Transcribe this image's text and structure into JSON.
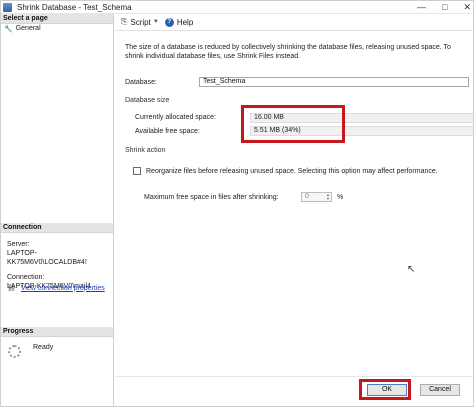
{
  "window": {
    "title": "Shrink Database - Test_Schema",
    "minimize": "—",
    "maximize": "□",
    "close": "✕"
  },
  "left_pane": {
    "select_page_header": "Select a page",
    "pages": [
      {
        "label": "General"
      }
    ],
    "connection_header": "Connection",
    "server_label": "Server:",
    "server_value": "LAPTOP-KK75M6V0\\LOCALDB#4!",
    "connection_label": "Connection:",
    "connection_value": "LAPTOP-KK75M6V0\\mail4",
    "view_connection_link": "View connection properties",
    "progress_header": "Progress",
    "progress_status": "Ready"
  },
  "toolbar": {
    "script_label": "Script",
    "help_label": "Help"
  },
  "description": "The size of a database is reduced by collectively shrinking the database files, releasing unused space. To shrink individual database files, use Shrink Files instead.",
  "database": {
    "label": "Database:",
    "value": "Test_Schema"
  },
  "database_size": {
    "section_title": "Database size",
    "allocated_label": "Currently allocated space:",
    "allocated_value": "16.00 MB",
    "free_label": "Available free space:",
    "free_value": "5.51 MB (34%)"
  },
  "shrink_action": {
    "section_title": "Shrink action",
    "reorganize_label": "Reorganize files before releasing unused space.  Selecting this option may affect performance.",
    "reorganize_checked": false,
    "max_free_label": "Maximum free space in files after shrinking:",
    "max_free_value": "0",
    "max_free_unit": "%"
  },
  "buttons": {
    "ok": "OK",
    "cancel": "Cancel"
  },
  "colors": {
    "highlight_red": "#c4171e",
    "link_blue": "#1f3fb8",
    "header_gray": "#e4e4e4"
  }
}
